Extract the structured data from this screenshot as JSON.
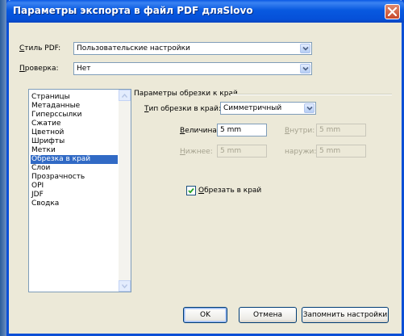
{
  "window": {
    "title": "Параметры экспорта в файл PDF дляSlovo"
  },
  "top": {
    "pdf_style_label_ul": "С",
    "pdf_style_label_rest": "тиль PDF:",
    "pdf_style_value": "Пользовательские настройки",
    "check_label_ul": "П",
    "check_label_rest": "роверка:",
    "check_value": "Нет"
  },
  "sidebar": {
    "items": [
      "Страницы",
      "Метаданные",
      "Гиперссылки",
      "Сжатие",
      "Цветной",
      "Шрифты",
      "Метки",
      "Обрезка в край",
      "Слои",
      "Прозрачность",
      "OPI",
      "JDF",
      "Сводка"
    ],
    "selected": "Обрезка в край"
  },
  "panel": {
    "group_title": "Параметры обрезки к край",
    "bleed_type_label_ul": "Т",
    "bleed_type_label_rest": "ип обрезки в край:",
    "bleed_type_value": "Симметричный",
    "size_label_ul": "В",
    "size_label_rest": "еличина:",
    "size_value": "5 mm",
    "inner_label_ul": "В",
    "inner_label_rest": "нутри:",
    "inner_value": "5 mm",
    "bottom_label_ul": "Н",
    "bottom_label_rest": "ижнее:",
    "bottom_value": "5 mm",
    "outer_label": "наружи:",
    "outer_value": "5 mm",
    "trim_checkbox_ul": "О",
    "trim_checkbox_rest": "брезать в край",
    "trim_checked": true
  },
  "buttons": {
    "ok": "OK",
    "cancel": "Отмена",
    "save": "Запомнить настройки"
  },
  "colors": {
    "title_bar": "#0a58e4",
    "selection": "#316ac5",
    "dialog_bg": "#ece9d8"
  }
}
